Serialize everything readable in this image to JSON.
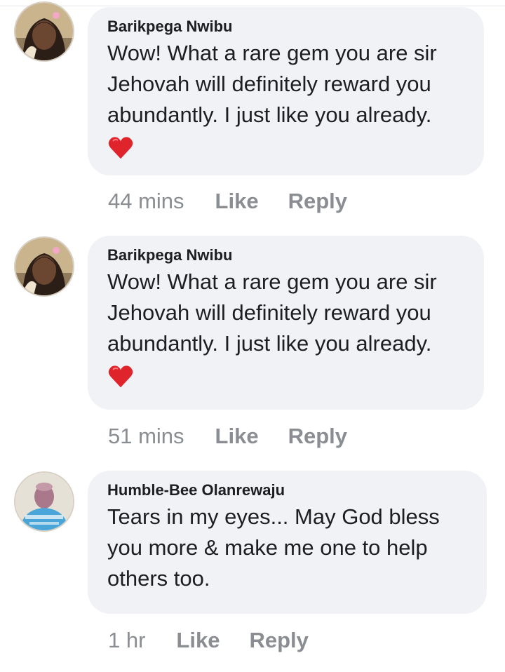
{
  "comments": [
    {
      "author": "Barikpega Nwibu",
      "text": "Wow! What a rare gem you are sir Jehovah will definitely reward you abundantly. I just like you already.",
      "lines": [
        "Wow! What a rare gem you are sir",
        "Jehovah will definitely reward you",
        "abundantly. I just like you already."
      ],
      "reaction_icon": "heart-icon",
      "time": "44 mins",
      "like_label": "Like",
      "reply_label": "Reply"
    },
    {
      "author": "Barikpega Nwibu",
      "text": "Wow! What a rare gem you are sir Jehovah will definitely reward you abundantly. I just like you already.",
      "lines": [
        "Wow! What a rare gem you are sir",
        "Jehovah will definitely reward you",
        "abundantly. I just like you already."
      ],
      "reaction_icon": "heart-icon",
      "time": "51 mins",
      "like_label": "Like",
      "reply_label": "Reply"
    },
    {
      "author": "Humble-Bee Olanrewaju",
      "text": "Tears in my eyes... May God bless you more & make me one to help others too.",
      "lines": [
        "Tears in my eyes... May God bless",
        "you more & make me one to help",
        "others too."
      ],
      "time": "1 hr",
      "like_label": "Like",
      "reply_label": "Reply"
    }
  ],
  "colors": {
    "bubble": "#f0f2f5",
    "meta_text": "#8a8d91",
    "heart": "#e0242c"
  }
}
